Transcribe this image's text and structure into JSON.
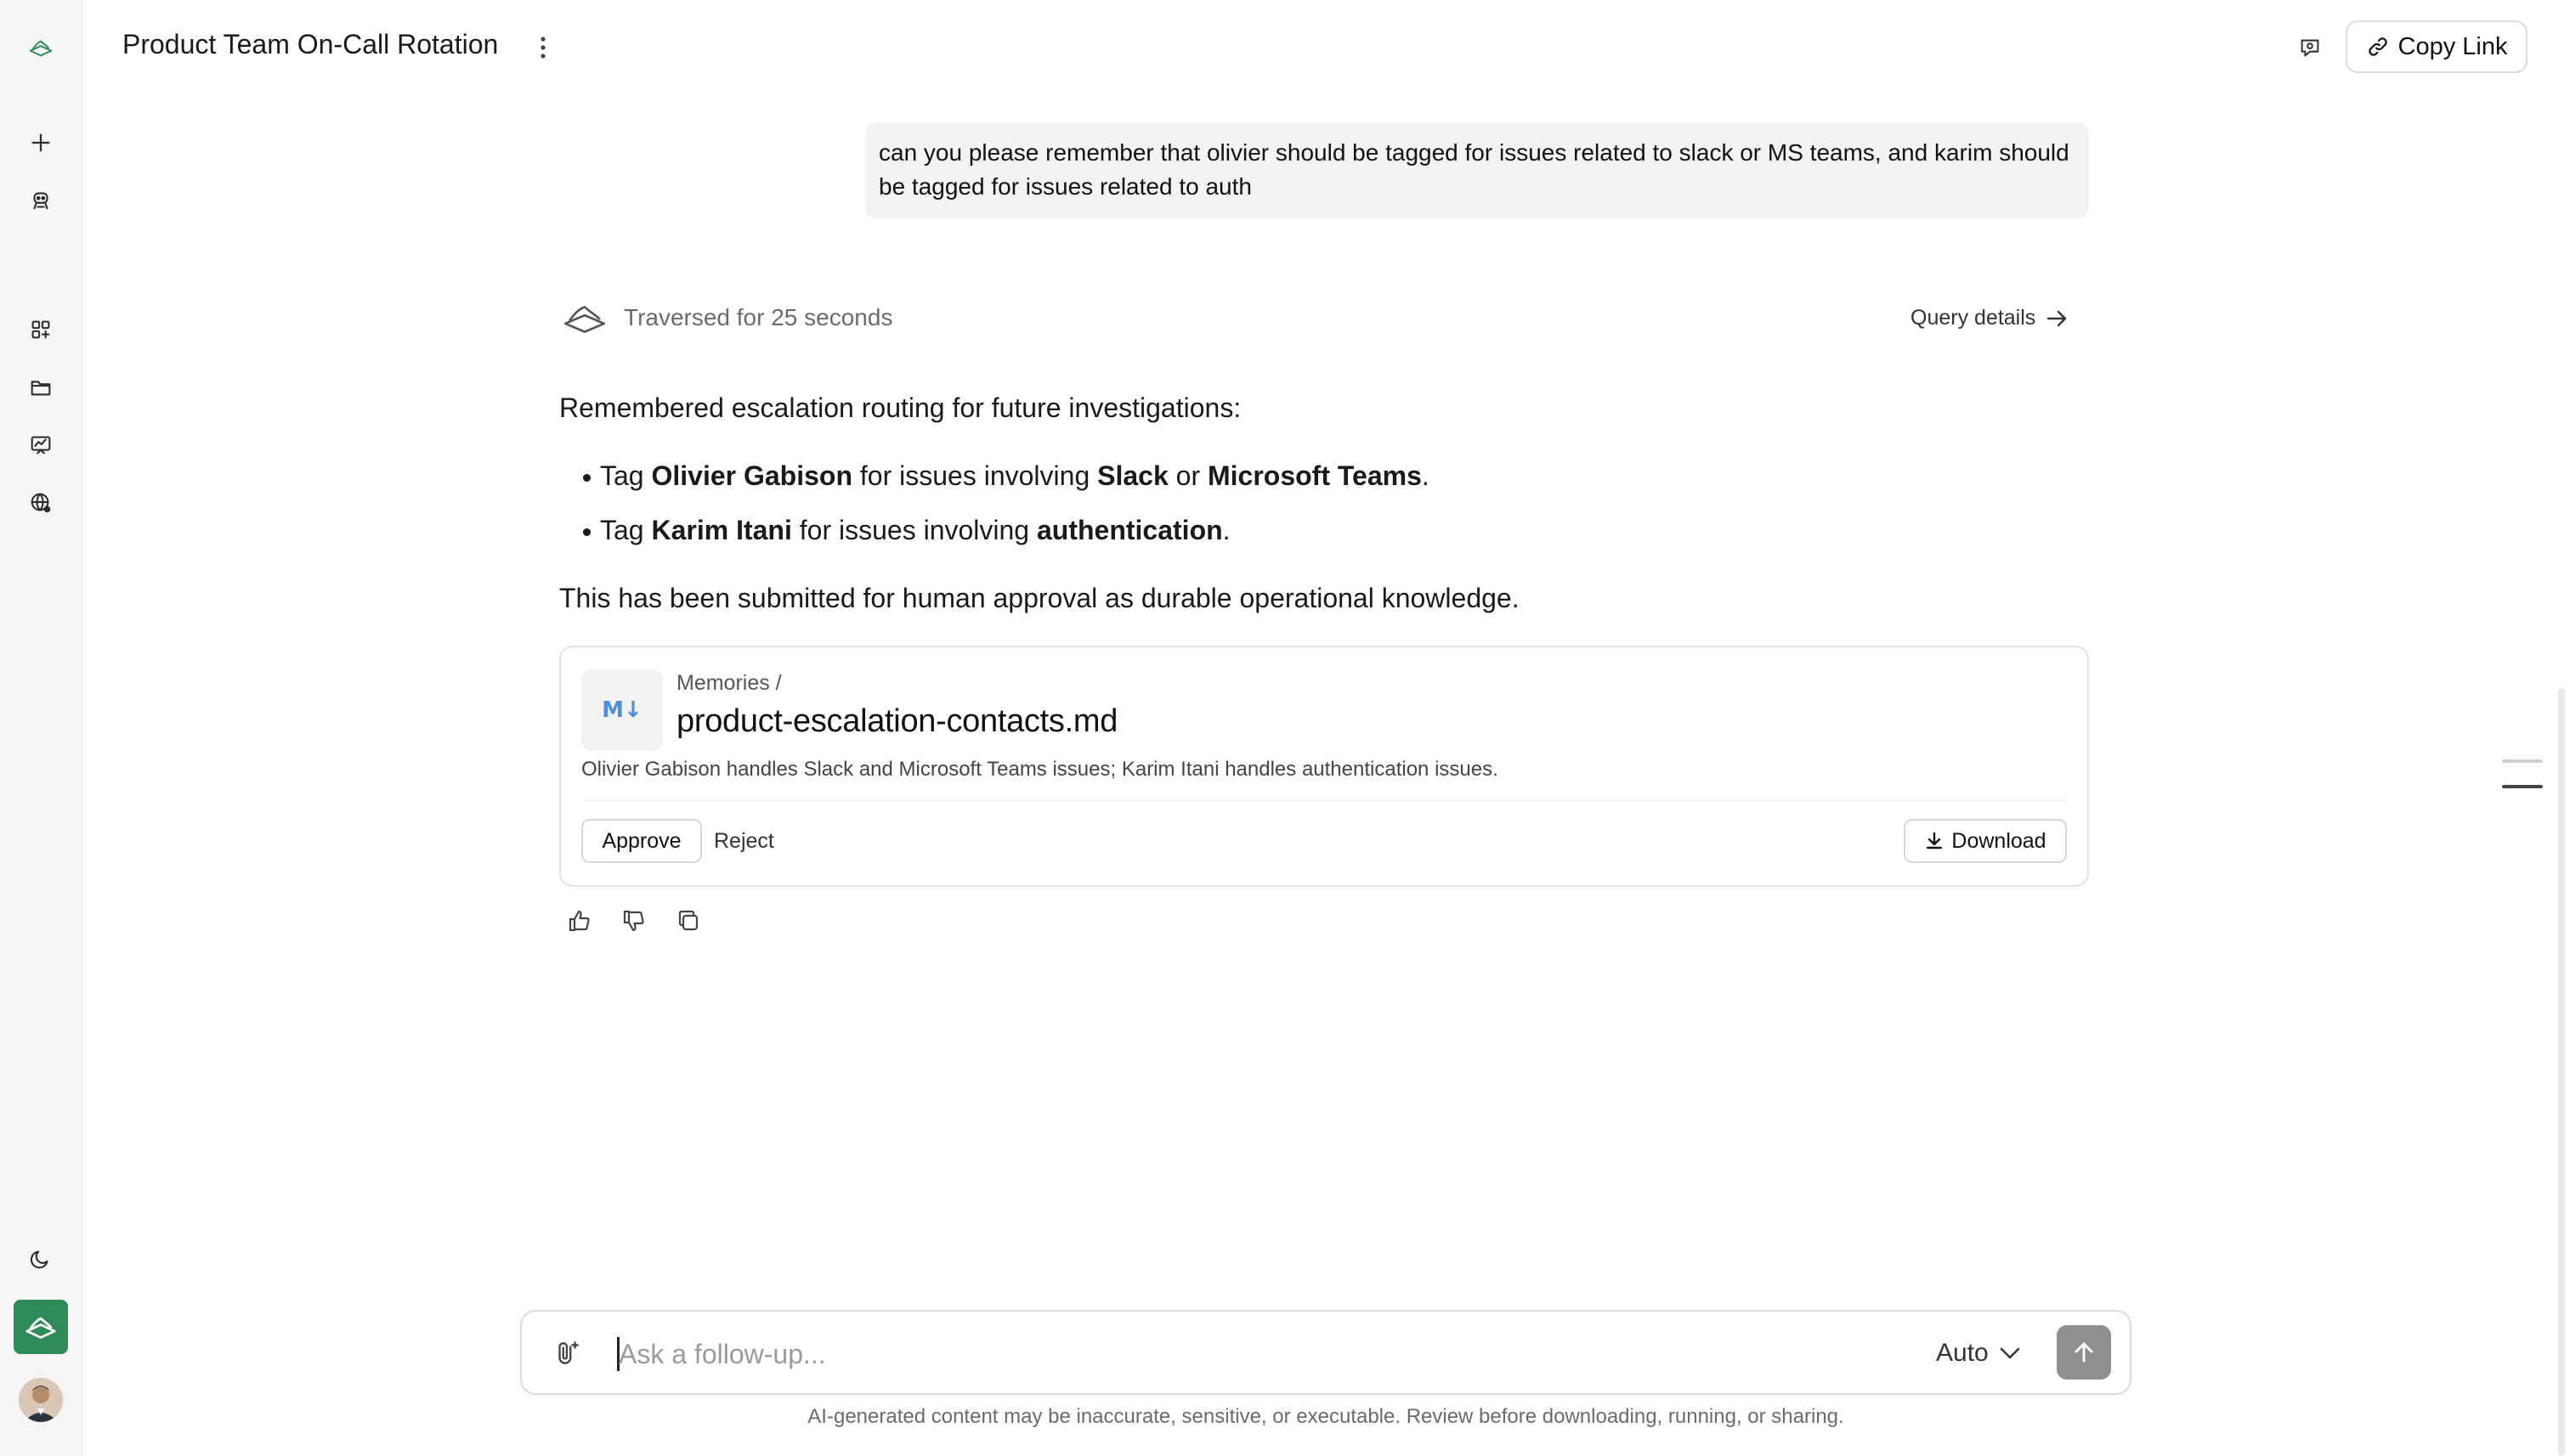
{
  "header": {
    "title": "Product Team On-Call Rotation",
    "copy_link_label": "Copy Link"
  },
  "sidebar": {
    "items": [
      {
        "name": "new-chat",
        "icon": "plus-icon"
      },
      {
        "name": "agent",
        "icon": "bot-icon"
      },
      {
        "name": "apps",
        "icon": "grid-plus-icon"
      },
      {
        "name": "files",
        "icon": "folder-icon"
      },
      {
        "name": "dashboards",
        "icon": "chart-board-icon"
      },
      {
        "name": "web",
        "icon": "globe-icon"
      },
      {
        "name": "theme",
        "icon": "moon-icon"
      }
    ],
    "accent_color": "#2e8b57"
  },
  "conversation": {
    "user_message": "can you please remember that olivier should be tagged for issues related to slack or MS teams, and karim should be tagged for issues related to auth",
    "traversal_text": "Traversed for 25 seconds",
    "query_details_label": "Query details",
    "intro": "Remembered escalation routing for future investigations:",
    "bullets": [
      {
        "t1": "Tag ",
        "b1": "Olivier Gabison",
        "t2": " for issues involving ",
        "b2": "Slack",
        "t3": " or ",
        "b3": "Microsoft Teams",
        "t4": "."
      },
      {
        "t1": "Tag ",
        "b1": "Karim Itani",
        "t2": " for issues involving ",
        "b2": "authentication",
        "t3": ".",
        "b3": "",
        "t4": ""
      }
    ],
    "outro": "This has been submitted for human approval as durable operational knowledge."
  },
  "memory_card": {
    "icon_label": "M↓",
    "path": "Memories /",
    "filename": "product-escalation-contacts.md",
    "description": "Olivier Gabison handles Slack and Microsoft Teams issues; Karim Itani handles authentication issues.",
    "approve_label": "Approve",
    "reject_label": "Reject",
    "download_label": "Download"
  },
  "composer": {
    "placeholder": "Ask a follow-up...",
    "value": "",
    "model": "Auto"
  },
  "disclaimer": "AI-generated content may be inaccurate, sensitive, or executable. Review before downloading, running, or sharing."
}
